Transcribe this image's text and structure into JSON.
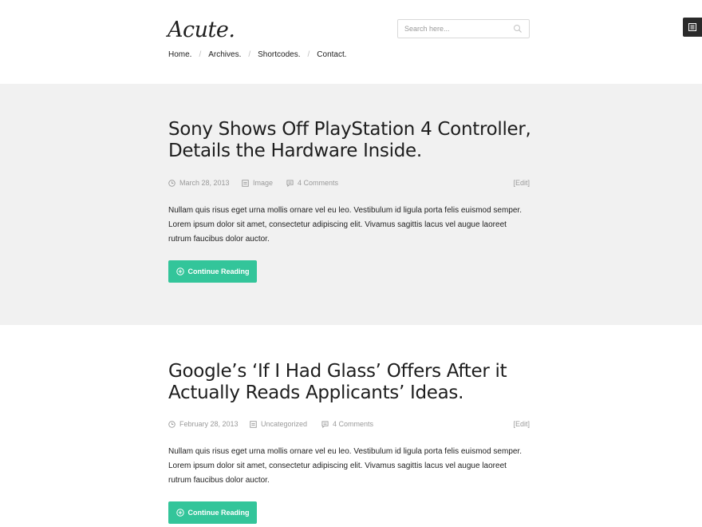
{
  "header": {
    "logo": "Acute.",
    "search_placeholder": "Search here...",
    "nav": [
      "Home.",
      "Archives.",
      "Shortcodes.",
      "Contact."
    ]
  },
  "posts": [
    {
      "title_line1": "Sony Shows Off PlayStation 4 Controller,",
      "title_line2": "Details the Hardware Inside.",
      "date": "March 28, 2013",
      "format": "Image",
      "comments": "4 Comments",
      "edit": "[Edit]",
      "excerpt": "Nullam quis risus eget urna mollis ornare vel eu leo. Vestibulum id ligula porta felis euismod semper. Lorem ipsum dolor sit amet, consectetur adipiscing elit. Vivamus sagittis lacus vel augue laoreet rutrum faucibus dolor auctor.",
      "button": "Continue Reading"
    },
    {
      "title_line1": "Google’s ‘If I Had Glass’ Offers After it",
      "title_line2": "Actually Reads Applicants’ Ideas.",
      "date": "February 28, 2013",
      "format": "Uncategorized",
      "comments": "4 Comments",
      "edit": "[Edit]",
      "excerpt": "Nullam quis risus eget urna mollis ornare vel eu leo. Vestibulum id ligula porta felis euismod semper. Lorem ipsum dolor sit amet, consectetur adipiscing elit. Vivamus sagittis lacus vel augue laoreet rutrum faucibus dolor auctor.",
      "button": "Continue Reading"
    }
  ],
  "colors": {
    "accent": "#33c59a",
    "post_background_alt": "#f1f1f1",
    "menu_toggle": "#2a2a2a"
  },
  "icons": [
    "search-icon",
    "menu-icon",
    "clock-icon",
    "image-format-icon",
    "comment-icon",
    "plus-circle-icon"
  ]
}
